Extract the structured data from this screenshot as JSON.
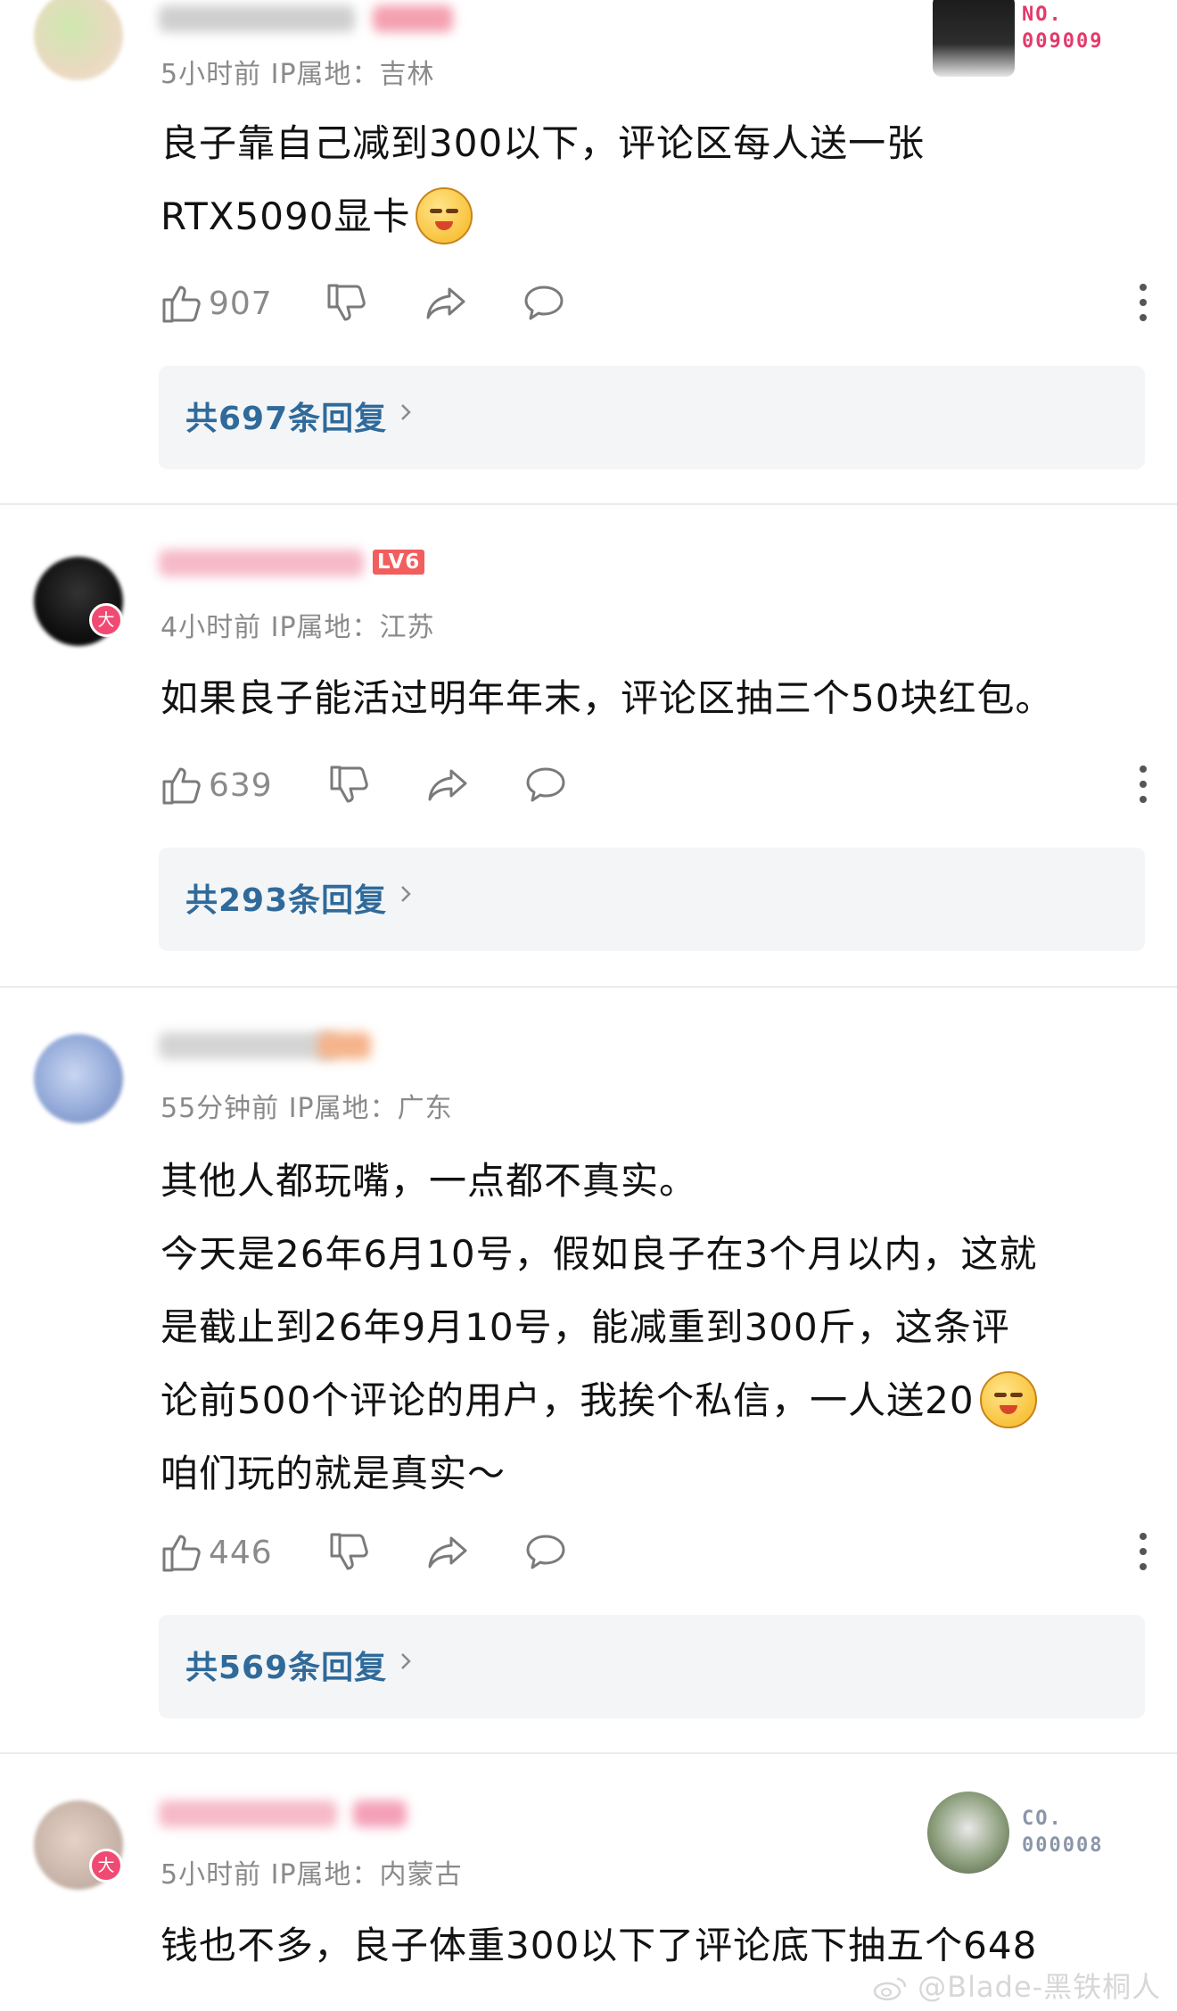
{
  "comments": [
    {
      "meta": "5小时前 IP属地：吉林",
      "lines": [
        "良子靠自己减到300以下，评论区每人送一张",
        "RTX5090显卡"
      ],
      "likes": "907",
      "replies": "共697条回复",
      "badge": null,
      "stamp": {
        "line1": "NO.",
        "line2": "009009",
        "color": "#e23a6a"
      }
    },
    {
      "meta": "4小时前 IP属地：江苏",
      "lines": [
        "如果良子能活过明年年末，评论区抽三个50块红包。"
      ],
      "likes": "639",
      "replies": "共293条回复",
      "badge": {
        "text": "大"
      },
      "level": "LV6"
    },
    {
      "meta": "55分钟前 IP属地：广东",
      "lines": [
        "其他人都玩嘴，一点都不真实。",
        "今天是26年6月10号，假如良子在3个月以内，这就",
        "是截止到26年9月10号，能减重到300斤，这条评",
        "论前500个评论的用户，我挨个私信，一人送20",
        "咱们玩的就是真实～"
      ],
      "likes": "446",
      "replies": "共569条回复",
      "badge": null
    },
    {
      "meta": "5小时前 IP属地：内蒙古",
      "lines": [
        "钱也不多，良子体重300以下了评论底下抽五个648"
      ],
      "likes": "",
      "replies": "",
      "badge": {
        "text": "大"
      },
      "stamp": {
        "line1": "CO.",
        "line2": "000008",
        "color": "#8a96a8"
      }
    }
  ],
  "watermark": "@Blade-黑铁桐人",
  "icons": {
    "like": "thumbs-up-icon",
    "dislike": "thumbs-down-icon",
    "share": "share-icon",
    "reply": "comment-bubble-icon",
    "more": "more-vertical-icon",
    "chevron": "chevron-right-icon",
    "weibo": "weibo-logo-icon"
  },
  "colors": {
    "reply_link": "#2f6a9a",
    "meta_gray": "#8a8a8a",
    "badge_pink": "#f04a72",
    "level_red": "#f25d5d"
  }
}
